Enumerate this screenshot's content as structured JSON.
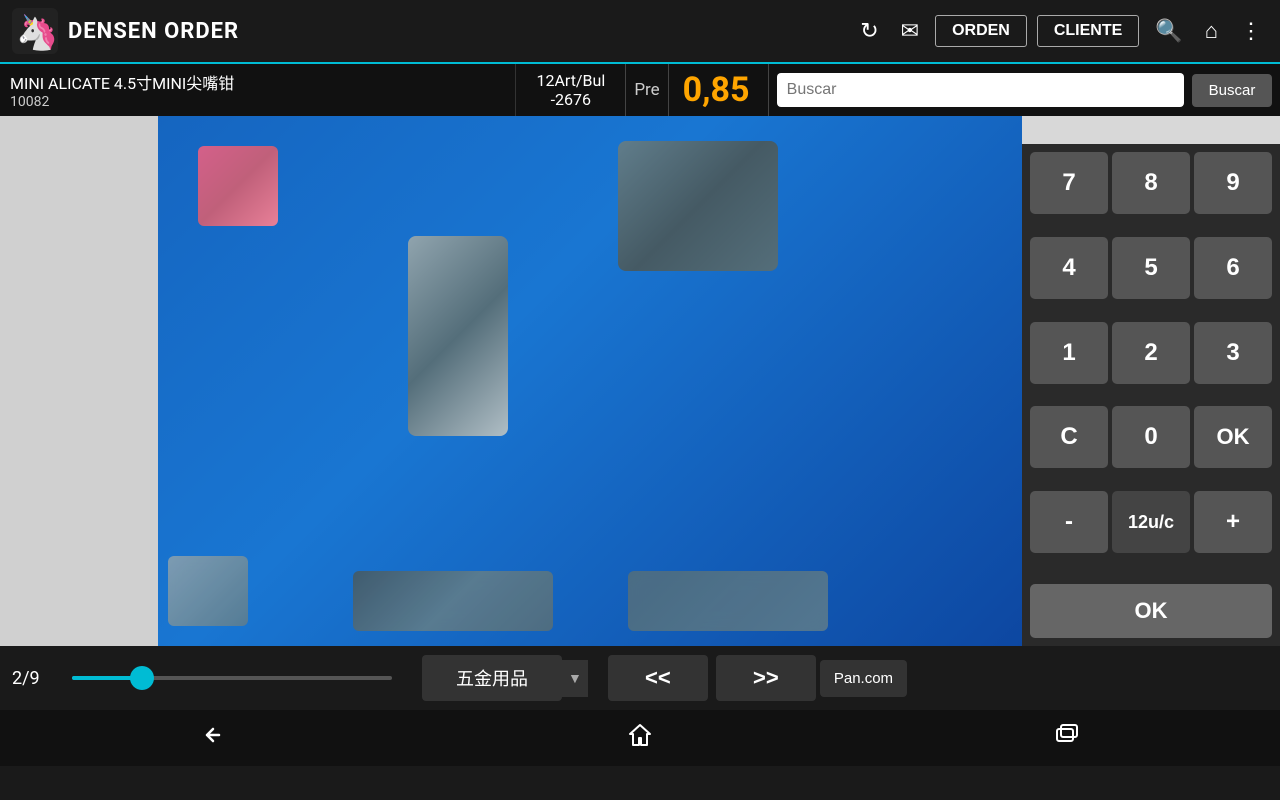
{
  "app": {
    "title": "DENSEN ORDER",
    "logo_alt": "unicorn-logo"
  },
  "topbar": {
    "refresh_icon": "↻",
    "mail_icon": "✉",
    "orden_label": "ORDEN",
    "cliente_label": "CLIENTE",
    "search_icon": "🔍",
    "home_icon": "⌂",
    "more_icon": "⋮"
  },
  "product": {
    "name": "MINI ALICATE 4.5寸MINI尖嘴钳",
    "code": "10082",
    "bulk": "12Art/Bul\n-2676",
    "bulk_line1": "12Art/Bul",
    "bulk_line2": "-2676",
    "pre_label": "Pre",
    "price": "0,85"
  },
  "search": {
    "placeholder": "Buscar",
    "button_label": "Buscar"
  },
  "numpad": {
    "buttons": [
      "7",
      "8",
      "9",
      "4",
      "5",
      "6",
      "1",
      "2",
      "3",
      "C",
      "0",
      "OK"
    ],
    "bottom_row": [
      "-",
      "12u/c",
      "+"
    ],
    "ok_label": "OK"
  },
  "bottom": {
    "page_indicator": "2/9",
    "category_label": "五金用品",
    "prev_btn": "<<",
    "next_btn": ">>",
    "pancom_label": "Pan.com"
  },
  "android_nav": {
    "back_icon": "←",
    "home_icon": "⬡",
    "recents_icon": "▭"
  }
}
